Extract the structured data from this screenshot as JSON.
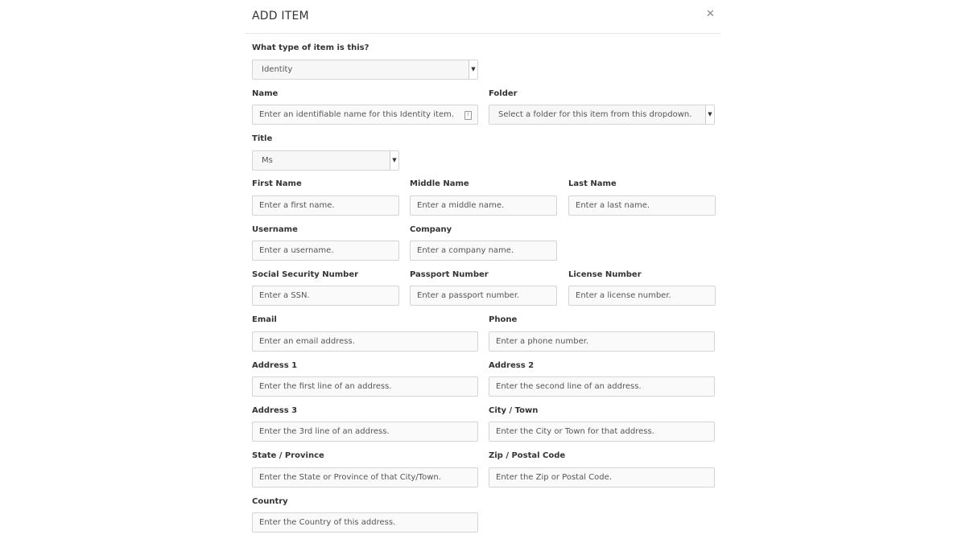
{
  "modal": {
    "title": "ADD ITEM",
    "close_icon": "close-icon"
  },
  "type_field": {
    "label": "What type of item is this?",
    "value": "Identity"
  },
  "name_field": {
    "label": "Name",
    "placeholder": "Enter an identifiable name for this Identity item."
  },
  "folder_field": {
    "label": "Folder",
    "placeholder": "Select a folder for this item from this dropdown."
  },
  "title_field": {
    "label": "Title",
    "value": "Ms"
  },
  "fields": [
    {
      "key": "first-name",
      "label": "First Name",
      "placeholder": "Enter a first name."
    },
    {
      "key": "middle-name",
      "label": "Middle Name",
      "placeholder": "Enter a middle name."
    },
    {
      "key": "last-name",
      "label": "Last Name",
      "placeholder": "Enter a last name."
    },
    {
      "key": "username",
      "label": "Username",
      "placeholder": "Enter a username."
    },
    {
      "key": "company",
      "label": "Company",
      "placeholder": "Enter a company name."
    },
    {
      "key": "ssn",
      "label": "Social Security Number",
      "placeholder": "Enter a SSN."
    },
    {
      "key": "passport",
      "label": "Passport Number",
      "placeholder": "Enter a passport number."
    },
    {
      "key": "license",
      "label": "License Number",
      "placeholder": "Enter a license number."
    },
    {
      "key": "email",
      "label": "Email",
      "placeholder": "Enter an email address."
    },
    {
      "key": "phone",
      "label": "Phone",
      "placeholder": "Enter a phone number."
    },
    {
      "key": "address1",
      "label": "Address 1",
      "placeholder": "Enter the first line of an address."
    },
    {
      "key": "address2",
      "label": "Address 2",
      "placeholder": "Enter the second line of an address."
    },
    {
      "key": "address3",
      "label": "Address 3",
      "placeholder": "Enter the 3rd line of an address."
    },
    {
      "key": "city",
      "label": "City / Town",
      "placeholder": "Enter the City or Town for that address."
    },
    {
      "key": "state",
      "label": "State / Province",
      "placeholder": "Enter the State or Province of that City/Town."
    },
    {
      "key": "zip",
      "label": "Zip / Postal Code",
      "placeholder": "Enter the Zip or Postal Code."
    },
    {
      "key": "country",
      "label": "Country",
      "placeholder": "Enter the Country of this address."
    }
  ]
}
